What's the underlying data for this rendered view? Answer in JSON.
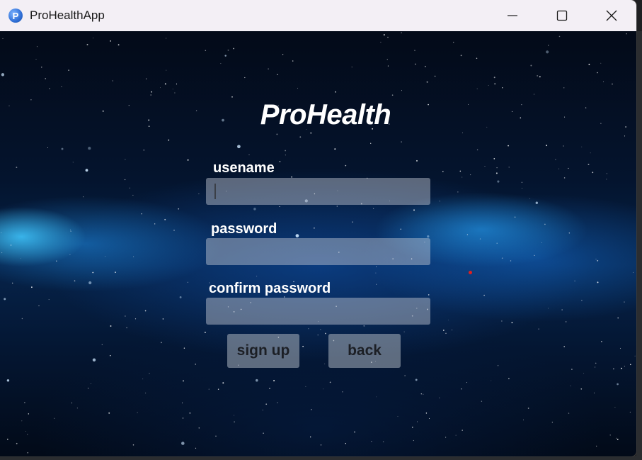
{
  "window": {
    "title": "ProHealthApp",
    "app_icon_letter": "P",
    "controls": [
      "minimize-icon",
      "maximize-icon",
      "close-icon"
    ]
  },
  "form": {
    "heading": "ProHealth",
    "username_label": "usename",
    "username_value": "",
    "password_label": "password",
    "password_value": "",
    "confirm_label": "confirm password",
    "confirm_value": "",
    "signup_button": "sign up",
    "back_button": "back"
  },
  "colors": {
    "titlebar": "#f3eff5",
    "field_fill": "#c8cdd7",
    "button_fill": "#aab2be",
    "button_text": "#1c1f25",
    "accent_dot": "#e02020"
  }
}
